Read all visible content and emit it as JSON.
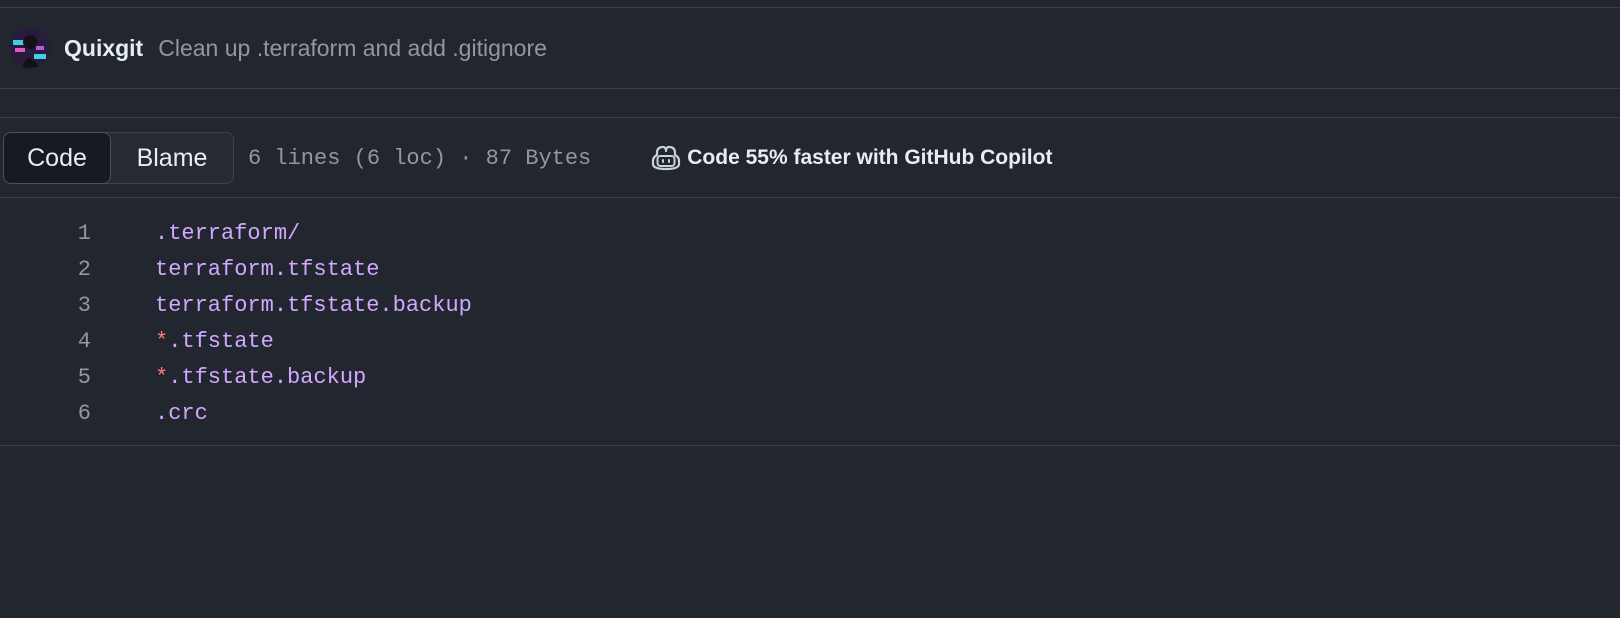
{
  "commit": {
    "author": "Quixgit",
    "message": "Clean up .terraform and add .gitignore"
  },
  "toolbar": {
    "code_label": "Code",
    "blame_label": "Blame",
    "file_info": "6 lines (6 loc) · 87 Bytes",
    "copilot_label": "Code 55% faster with GitHub Copilot"
  },
  "code": {
    "lines": [
      {
        "number": "1",
        "prefix": "",
        "text": ".terraform/"
      },
      {
        "number": "2",
        "prefix": "",
        "text": "terraform.tfstate"
      },
      {
        "number": "3",
        "prefix": "",
        "text": "terraform.tfstate.backup"
      },
      {
        "number": "4",
        "prefix": "*",
        "text": ".tfstate"
      },
      {
        "number": "5",
        "prefix": "*",
        "text": ".tfstate.backup"
      },
      {
        "number": "6",
        "prefix": "",
        "text": ".crc"
      }
    ]
  },
  "colors": {
    "background": "#22262e",
    "line_number": "#9198a1",
    "code_text": "#d2a8ff",
    "glob_star": "#ff7b72"
  },
  "icons": {
    "avatar": "user-avatar",
    "copilot": "copilot-icon"
  }
}
